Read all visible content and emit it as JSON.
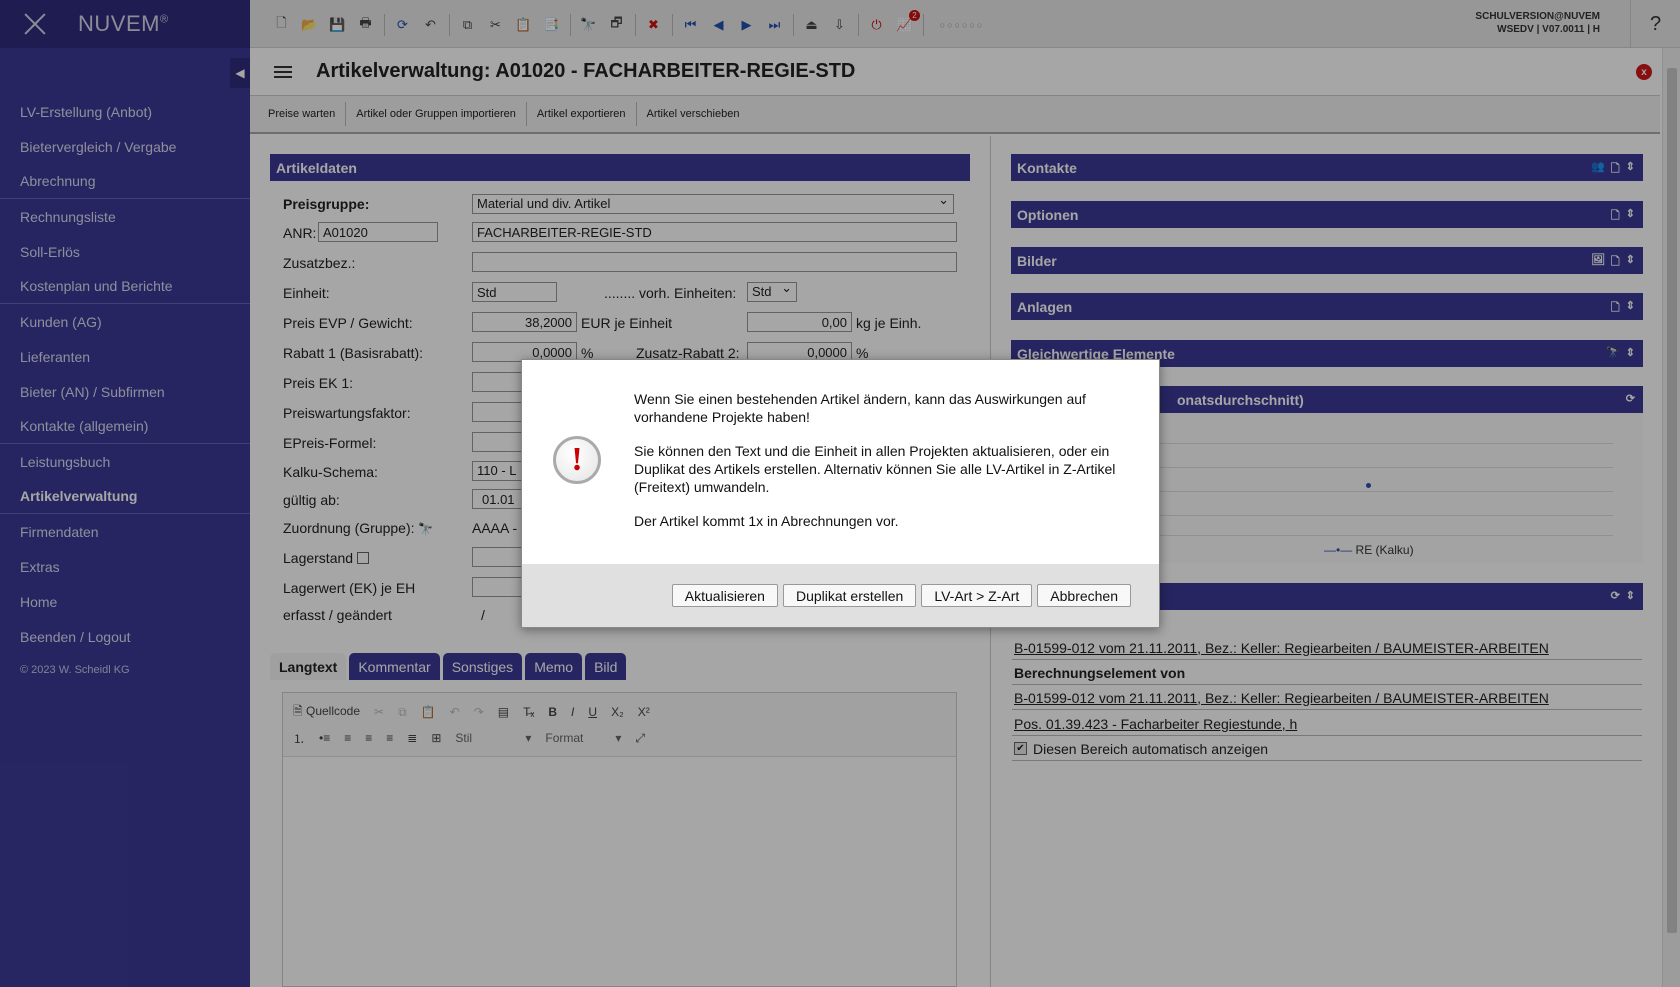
{
  "app": {
    "brand": "NUVEM",
    "brand_mark": "®"
  },
  "sidebar": {
    "items": [
      {
        "label": "LV-Erstellung (Anbot)"
      },
      {
        "label": "Bietervergleich / Vergabe"
      },
      {
        "label": "Abrechnung"
      },
      {
        "label": "Rechnungsliste"
      },
      {
        "label": "Soll-Erlös"
      },
      {
        "label": "Kostenplan und Berichte"
      },
      {
        "label": "Kunden (AG)"
      },
      {
        "label": "Lieferanten"
      },
      {
        "label": "Bieter (AN) / Subfirmen"
      },
      {
        "label": "Kontakte (allgemein)"
      },
      {
        "label": "Leistungsbuch"
      },
      {
        "label": "Artikelverwaltung"
      },
      {
        "label": "Firmendaten"
      },
      {
        "label": "Extras"
      },
      {
        "label": "Home"
      },
      {
        "label": "Beenden / Logout"
      }
    ],
    "copyright": "© 2023 W. Scheidl KG"
  },
  "header": {
    "user_line1": "SCHULVERSION@NUVEM",
    "user_line2": "WSEDV | V07.0011 | H",
    "help": "?",
    "badge_count": "2"
  },
  "page": {
    "title": "Artikelverwaltung: A01020 - FACHARBEITER-REGIE-STD",
    "close": "x"
  },
  "subbar": {
    "buttons": [
      "Preise warten",
      "Artikel oder Gruppen importieren",
      "Artikel exportieren",
      "Artikel verschieben"
    ]
  },
  "artikeldaten": {
    "title": "Artikeldaten",
    "preisgruppe_label": "Preisgruppe:",
    "preisgruppe_value": "Material und div. Artikel",
    "anr_label": "ANR:",
    "anr_value": "A01020",
    "bezeichnung_value": "FACHARBEITER-REGIE-STD",
    "zusatzbez_label": "Zusatzbez.:",
    "einheit_label": "Einheit:",
    "einheit_value": "Std",
    "vorh_einheiten_label": "........ vorh. Einheiten:",
    "vorh_einheiten_value": "Std",
    "preis_evp_label": "Preis EVP / Gewicht:",
    "preis_evp_value": "38,2000",
    "preis_evp_unit": "EUR je Einheit",
    "gewicht_value": "0,00",
    "gewicht_unit": "kg je Einh.",
    "rabatt1_label": "Rabatt 1 (Basisrabatt):",
    "rabatt1_value": "0,0000",
    "rabatt1_unit": "%",
    "zusatz_rabatt_label": "Zusatz-Rabatt 2:",
    "zusatz_rabatt_value": "0,0000",
    "zusatz_rabatt_unit": "%",
    "preis_ek1_label": "Preis EK 1:",
    "preiswartung_label": "Preiswartungsfaktor:",
    "epreis_label": "EPreis-Formel:",
    "kalku_label": "Kalku-Schema:",
    "kalku_value": "110 - L",
    "gueltig_label": "gültig ab:",
    "gueltig_value": "01.01",
    "zuordnung_label": "Zuordnung (Gruppe):",
    "zuordnung_value": "AAAA -",
    "lagerstand_label": "Lagerstand",
    "lagerwert_label": "Lagerwert (EK) je EH",
    "erfasst_label": "erfasst / geändert",
    "erfasst_value": "/"
  },
  "tabs": [
    "Langtext",
    "Kommentar",
    "Sonstiges",
    "Memo",
    "Bild"
  ],
  "editor": {
    "source": "Quellcode",
    "style": "Stil",
    "format": "Format"
  },
  "right_panels": {
    "kontakte": "Kontakte",
    "optionen": "Optionen",
    "bilder": "Bilder",
    "anlagen": "Anlagen",
    "gleichwertige": "Gleichwertige Elemente",
    "chart_title_partial": "onatsdurchschnitt)",
    "chart_legend": "RE (Kalku)"
  },
  "references": {
    "row1": "B-01599-012 vom 21.11.2011, Bez.: Keller: Regiearbeiten / BAUMEISTER-ARBEITEN",
    "heading": "Berechnungselement von",
    "row2": "B-01599-012 vom 21.11.2011, Bez.: Keller: Regiearbeiten / BAUMEISTER-ARBEITEN",
    "row3": "Pos. 01.39.423 - Facharbeiter Regiestunde, h",
    "auto_show": "Diesen Bereich automatisch anzeigen"
  },
  "dialog": {
    "line1": "Wenn Sie einen bestehenden Artikel ändern, kann das Auswirkungen auf vorhandene Projekte haben!",
    "line2": "Sie können den Text und die Einheit in allen Projekten aktualisieren, oder ein Duplikat des Artikels erstellen. Alternativ können Sie alle LV-Artikel in Z-Artikel (Freitext) umwandeln.",
    "line3": "Der Artikel kommt 1x in Abrechnungen vor.",
    "icon_glyph": "!",
    "buttons": {
      "update": "Aktualisieren",
      "duplicate": "Duplikat erstellen",
      "convert": "LV-Art > Z-Art",
      "cancel": "Abbrechen"
    }
  }
}
